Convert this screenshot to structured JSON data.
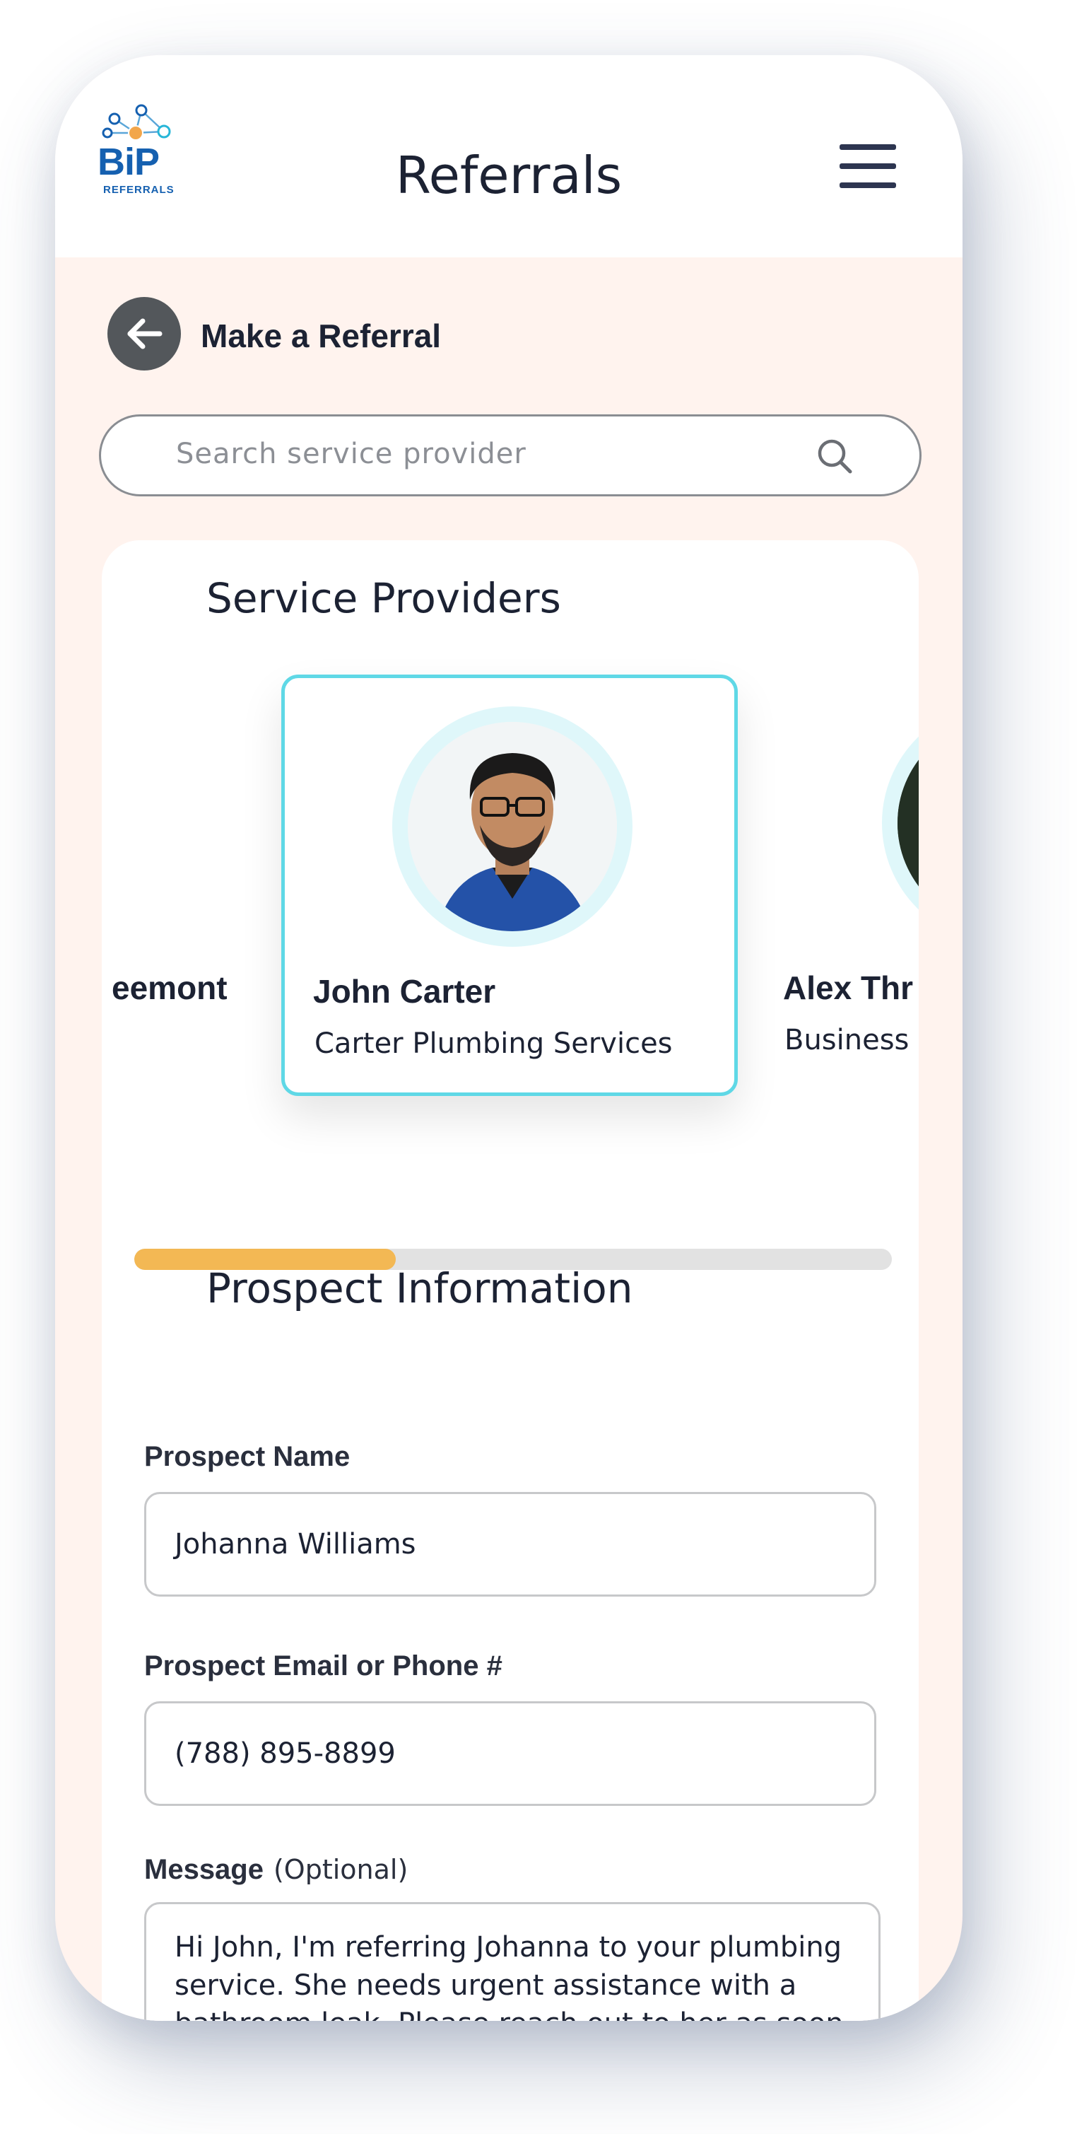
{
  "app": {
    "logo_text": "BiP",
    "logo_subtext": "REFERRALS",
    "title": "Referrals"
  },
  "icons": {
    "menu": "hamburger-menu-icon",
    "back": "arrow-left-icon",
    "search": "search-icon"
  },
  "colors": {
    "accent_cyan": "#5fd8e6",
    "progress_fill": "#f3b854",
    "brand_blue": "#1560b0",
    "page_bg": "#fff3ee"
  },
  "header": {
    "back_label": "Make a Referral"
  },
  "search": {
    "placeholder": "Search service provider"
  },
  "service_providers": {
    "title": "Service Providers",
    "items": [
      {
        "name": "eemont",
        "business": ""
      },
      {
        "name": "John Carter",
        "business": "Carter Plumbing Services",
        "selected": true
      },
      {
        "name": "Alex Thr",
        "business": "Business"
      }
    ]
  },
  "carousel_progress": {
    "fraction": 0.345
  },
  "prospect": {
    "title": "Prospect Information",
    "name_label": "Prospect Name",
    "name_value": "Johanna Williams",
    "contact_label": "Prospect Email or Phone #",
    "contact_value": "(788) 895-8899",
    "message_label": "Message",
    "message_optional": "(Optional)",
    "message_value": "Hi John, I'm referring Johanna to your plumbing service. She needs urgent assistance with a bathroom leak. Please reach out to her as soon as possible."
  }
}
